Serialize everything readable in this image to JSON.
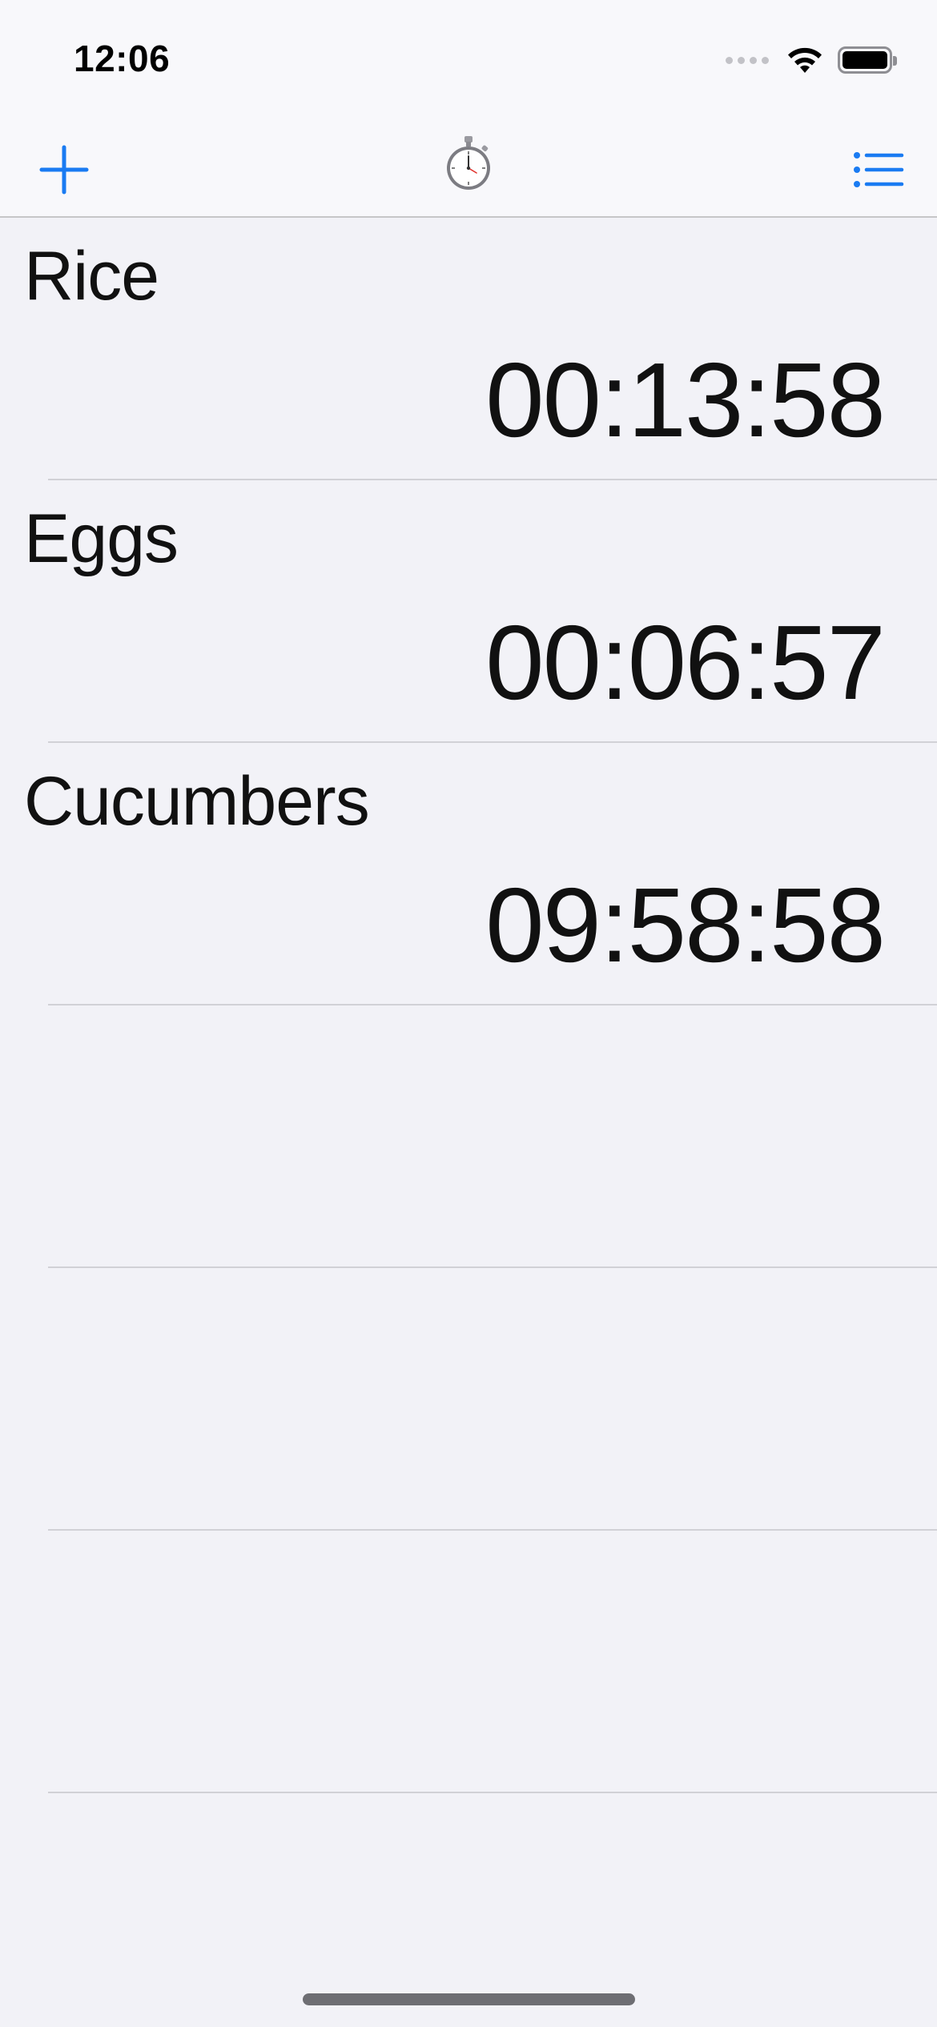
{
  "status_bar": {
    "time": "12:06"
  },
  "nav_bar": {
    "add_icon": "plus-icon",
    "title_icon": "stopwatch-icon",
    "menu_icon": "list-icon",
    "accent_color": "#1a7bf2"
  },
  "timers": [
    {
      "name": "Rice",
      "time": "00:13:58"
    },
    {
      "name": "Eggs",
      "time": "00:06:57"
    },
    {
      "name": "Cucumbers",
      "time": "09:58:58"
    },
    {
      "name": "",
      "time": ""
    },
    {
      "name": "",
      "time": ""
    },
    {
      "name": "",
      "time": ""
    }
  ]
}
